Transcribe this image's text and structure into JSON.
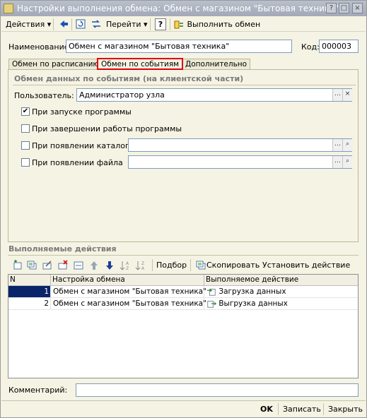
{
  "window": {
    "title": "Настройки выполнения обмена: Обмен с магазином \"Бытовая техника\""
  },
  "toolbar": {
    "actions_label": "Действия",
    "goto_label": "Перейти",
    "help_label": "?",
    "execute_label": "Выполнить обмен"
  },
  "form": {
    "name_label": "Наименование:",
    "name_value": "Обмен с магазином \"Бытовая техника\"",
    "code_label": "Код:",
    "code_value": "000003"
  },
  "tabs": [
    {
      "label": "Обмен по расписанию"
    },
    {
      "label": "Обмен по событиям"
    },
    {
      "label": "Дополнительно"
    }
  ],
  "events": {
    "group_title": "Обмен данных по событиям (на клиентской части)",
    "user_label": "Пользователь:",
    "user_value": "Администратор узла",
    "on_start_label": "При запуске программы",
    "on_start_checked": true,
    "on_exit_label": "При завершении работы программы",
    "on_exit_checked": false,
    "on_dir_label": "При появлении каталога",
    "on_dir_checked": false,
    "on_file_label": "При появлении файла",
    "on_file_checked": false
  },
  "actions": {
    "group_title": "Выполняемые действия",
    "pick_label": "Подбор",
    "copy_label": "Скопировать",
    "set_action_label": "Установить действие",
    "columns": [
      "N",
      "Настройка обмена",
      "Выполняемое действие"
    ],
    "rows": [
      {
        "n": "1",
        "setting": "Обмен с магазином \"Бытовая техника\"",
        "action": "Загрузка данных"
      },
      {
        "n": "2",
        "setting": "Обмен с магазином \"Бытовая техника\"",
        "action": "Выгрузка данных"
      }
    ]
  },
  "comment": {
    "label": "Комментарий:",
    "value": ""
  },
  "footer": {
    "ok_label": "OK",
    "save_label": "Записать",
    "close_label": "Закрыть"
  },
  "colors": {
    "tab_highlight": "#e0000e",
    "selected_cell": "#0a246a"
  }
}
